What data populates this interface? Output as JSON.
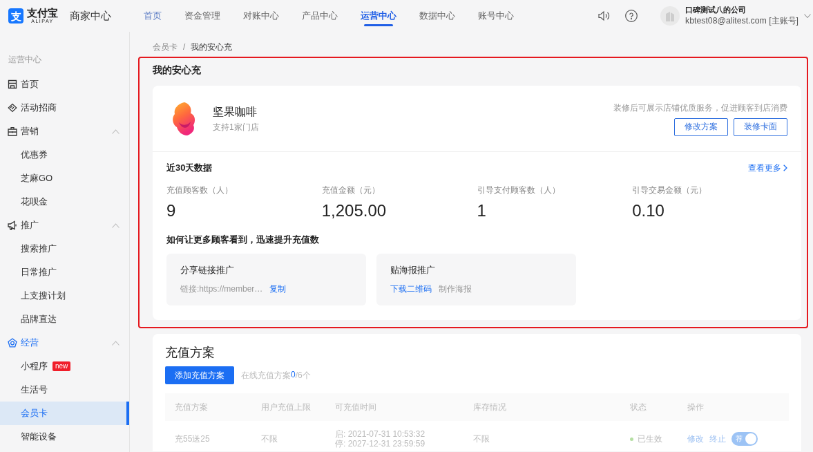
{
  "header": {
    "logo": {
      "mark": "支",
      "name": "支付宝",
      "sub": "ALIPAY"
    },
    "product": "商家中心",
    "nav": [
      {
        "label": "首页",
        "selected": false,
        "hovered": true
      },
      {
        "label": "资金管理",
        "selected": false,
        "hovered": false
      },
      {
        "label": "对账中心",
        "selected": false,
        "hovered": false
      },
      {
        "label": "产品中心",
        "selected": false,
        "hovered": false
      },
      {
        "label": "运营中心",
        "selected": true,
        "hovered": false
      },
      {
        "label": "数据中心",
        "selected": false,
        "hovered": false
      },
      {
        "label": "账号中心",
        "selected": false,
        "hovered": false
      }
    ],
    "user": {
      "company": "口碑测试八的公司",
      "account": "kbtest08@alitest.com [主账号]"
    }
  },
  "sidebar": {
    "title": "运营中心",
    "items": [
      {
        "kind": "link",
        "label": "首页",
        "selected": false
      },
      {
        "kind": "link",
        "label": "活动招商",
        "selected": false
      },
      {
        "kind": "group",
        "label": "营销",
        "active": false,
        "expanded": true,
        "children": [
          {
            "label": "优惠券",
            "selected": false
          },
          {
            "label": "芝麻GO",
            "selected": false
          },
          {
            "label": "花呗金",
            "selected": false
          }
        ]
      },
      {
        "kind": "group",
        "label": "推广",
        "active": false,
        "expanded": true,
        "children": [
          {
            "label": "搜索推广",
            "selected": false
          },
          {
            "label": "日常推广",
            "selected": false
          },
          {
            "label": "上支搜计划",
            "selected": false
          },
          {
            "label": "品牌直达",
            "selected": false
          }
        ]
      },
      {
        "kind": "group",
        "label": "经营",
        "active": true,
        "expanded": true,
        "children": [
          {
            "label": "小程序",
            "selected": false,
            "badge": "new"
          },
          {
            "label": "生活号",
            "selected": false
          },
          {
            "label": "会员卡",
            "selected": true
          },
          {
            "label": "智能设备",
            "selected": false
          }
        ]
      }
    ]
  },
  "breadcrumb": {
    "items": [
      "会员卡",
      "我的安心充"
    ],
    "separator": "/"
  },
  "overview": {
    "highlighted": true,
    "title": "我的安心充",
    "shop": {
      "name": "坚果咖啡",
      "stores": "支持1家门店"
    },
    "hint": "装修后可展示店铺优质服务，促进顾客到店消费",
    "buttons": [
      "修改方案",
      "装修卡面"
    ],
    "stats": {
      "title": "近30天数据",
      "more": "查看更多",
      "items": [
        {
          "label": "充值顾客数（人）",
          "value": "9"
        },
        {
          "label": "充值金额（元）",
          "value": "1,205.00"
        },
        {
          "label": "引导支付顾客数（人）",
          "value": "1"
        },
        {
          "label": "引导交易金额（元）",
          "value": "0.10"
        }
      ]
    },
    "promotion": {
      "title": "如何让更多顾客看到，迅速提升充值数",
      "cards": [
        {
          "title": "分享链接推广",
          "links": [
            {
              "kind": "text",
              "label": "链接:https://member…"
            },
            {
              "kind": "link",
              "label": "复制"
            }
          ]
        },
        {
          "title": "贴海报推广",
          "links": [
            {
              "kind": "link",
              "label": "下载二维码"
            },
            {
              "kind": "text",
              "label": "制作海报"
            }
          ]
        }
      ]
    }
  },
  "plans": {
    "title": "充值方案",
    "add_button": "添加充值方案",
    "online": {
      "prefix": "在线充值方案",
      "count": "0",
      "suffix": "/6个"
    },
    "table": {
      "columns": [
        "充值方案",
        "用户充值上限",
        "可充值时间",
        "库存情况",
        "状态",
        "操作"
      ],
      "rows": [
        {
          "plan": "充55送25",
          "limit": "不限",
          "time": [
            "启: 2021-07-31 10:53:32",
            "停: 2027-12-31 23:59:59"
          ],
          "stock": "不限",
          "status": {
            "label": "已生效",
            "active": true
          },
          "actions": [
            "修改",
            "终止"
          ],
          "switch": {
            "label": "荐",
            "on": true
          }
        }
      ]
    }
  }
}
